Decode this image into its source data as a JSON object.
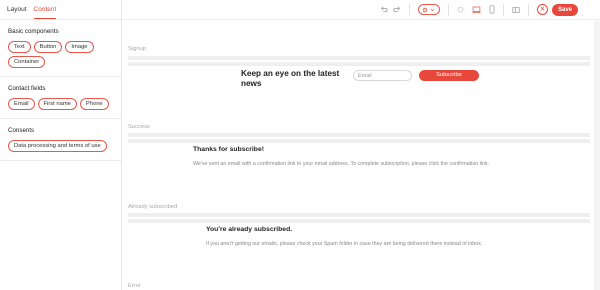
{
  "sidebar": {
    "tabs": [
      "Layout",
      "Content"
    ],
    "active_tab": "Content",
    "sections": [
      {
        "title": "Basic components",
        "items": [
          "Text",
          "Button",
          "Image",
          "Container"
        ]
      },
      {
        "title": "Contact fields",
        "items": [
          "Email",
          "First name",
          "Phone"
        ]
      },
      {
        "title": "Consents",
        "items": [
          "Data processing and terms of use"
        ]
      }
    ]
  },
  "toolbar": {
    "undo_icon": "undo-icon",
    "redo_icon": "redo-icon",
    "device_icon": "settings-icon",
    "save_label": "Save",
    "close_icon": "close-icon"
  },
  "canvas": {
    "signup": {
      "label": "Signup",
      "title": "Keep an eye on the latest news",
      "email_placeholder": "Email",
      "button_label": "Subscribe"
    },
    "success": {
      "label": "Success",
      "title": "Thanks for subscribe!",
      "text": "We've sent an email with a confirmation link to your email address. To complete subscription, please click the confirmation link."
    },
    "already": {
      "label": "Already subscribed",
      "title": "You're already subscribed.",
      "text": "If you aren't getting our emails, please check your Spam folder in case they are being delivered there instead of inbox."
    },
    "error": {
      "label": "Error"
    }
  },
  "colors": {
    "accent": "#e8483b",
    "chip_border": "#e8584c",
    "placeholder_bar": "#efefef"
  }
}
